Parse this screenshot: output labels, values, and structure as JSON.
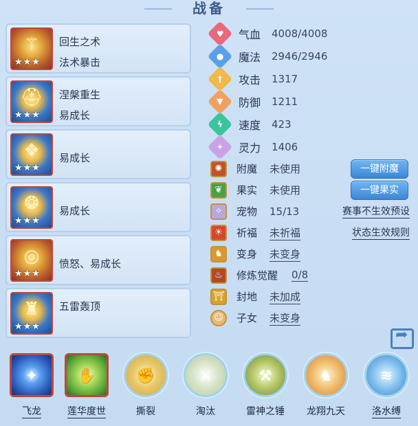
{
  "title": "战备",
  "equipment": [
    {
      "line1": "回生之术",
      "line2": "法术暴击",
      "stars": "★★★",
      "icon": "staff-icon"
    },
    {
      "line1": "涅槃重生",
      "line2": "易成长",
      "stars": "★★★",
      "icon": "helmet-icon"
    },
    {
      "line1": "",
      "line2": "易成长",
      "stars": "★★★",
      "icon": "armor-icon"
    },
    {
      "line1": "",
      "line2": "易成长",
      "stars": "★★★",
      "icon": "necklace-icon"
    },
    {
      "line1": "",
      "line2": "愤怒、易成长",
      "stars": "★★★",
      "icon": "belt-icon"
    },
    {
      "line1": "五雷轰顶",
      "line2": "",
      "stars": "★★★",
      "icon": "boots-icon"
    }
  ],
  "stats": [
    {
      "label": "气血",
      "value": "4008/4008",
      "color": "#e9687a",
      "icon": "heart-icon"
    },
    {
      "label": "魔法",
      "value": "2946/2946",
      "color": "#5aa0e6",
      "icon": "mana-icon"
    },
    {
      "label": "攻击",
      "value": "1317",
      "color": "#f0b94a",
      "icon": "sword-icon"
    },
    {
      "label": "防御",
      "value": "1211",
      "color": "#f0a060",
      "icon": "shield-icon"
    },
    {
      "label": "速度",
      "value": "423",
      "color": "#3cc59a",
      "icon": "speed-icon"
    },
    {
      "label": "灵力",
      "value": "1406",
      "color": "#c9a2e6",
      "icon": "spirit-icon"
    }
  ],
  "status": [
    {
      "label": "附魔",
      "value": "未使用",
      "button": "一键附魔",
      "icon": "enchant-icon",
      "icon_color": "#c0532e"
    },
    {
      "label": "果实",
      "value": "未使用",
      "button": "一键果实",
      "icon": "fruit-icon",
      "icon_color": "#4aa046"
    },
    {
      "label": "宠物",
      "value": "15/13",
      "right_link": "赛事不生效预设",
      "icon": "pet-icon",
      "icon_color": "#b9a8d8"
    },
    {
      "label": "祈福",
      "value": "未祈福",
      "right_link": "状态生效规则",
      "icon": "blessing-icon",
      "icon_color": "#d8462e"
    },
    {
      "label": "变身",
      "value": "未变身",
      "icon": "transform-icon",
      "icon_color": "#d89a2e"
    },
    {
      "label": "修炼觉醒",
      "value": "0/8",
      "icon": "cultivate-icon",
      "icon_color": "#b0482a"
    },
    {
      "label": "封地",
      "value": "未加成",
      "icon": "fief-icon",
      "icon_color": "#d8a22e"
    },
    {
      "label": "子女",
      "value": "未变身",
      "icon": "child-icon",
      "icon_color": "#e8b878"
    }
  ],
  "skills": [
    {
      "label": "飞龙",
      "icon": "dragon-orb-icon",
      "square": true,
      "underline": true,
      "bg": "#2a58b8"
    },
    {
      "label": "莲华度世",
      "icon": "lotus-hand-icon",
      "square": true,
      "underline": true,
      "bg": "#5aa83a"
    },
    {
      "label": "撕裂",
      "icon": "claw-icon",
      "square": false,
      "underline": false,
      "bg": "#c9a84a"
    },
    {
      "label": "淘汰",
      "icon": "blade-icon",
      "square": false,
      "underline": false,
      "bg": "#b8c8a0"
    },
    {
      "label": "雷神之锤",
      "icon": "hammer-icon",
      "square": false,
      "underline": false,
      "bg": "#8fa84a"
    },
    {
      "label": "龙翔九天",
      "icon": "warrior-icon",
      "square": false,
      "underline": false,
      "bg": "#e8a050"
    },
    {
      "label": "洛水缚",
      "icon": "water-bind-icon",
      "square": false,
      "underline": true,
      "bg": "#4a9ad8"
    }
  ]
}
